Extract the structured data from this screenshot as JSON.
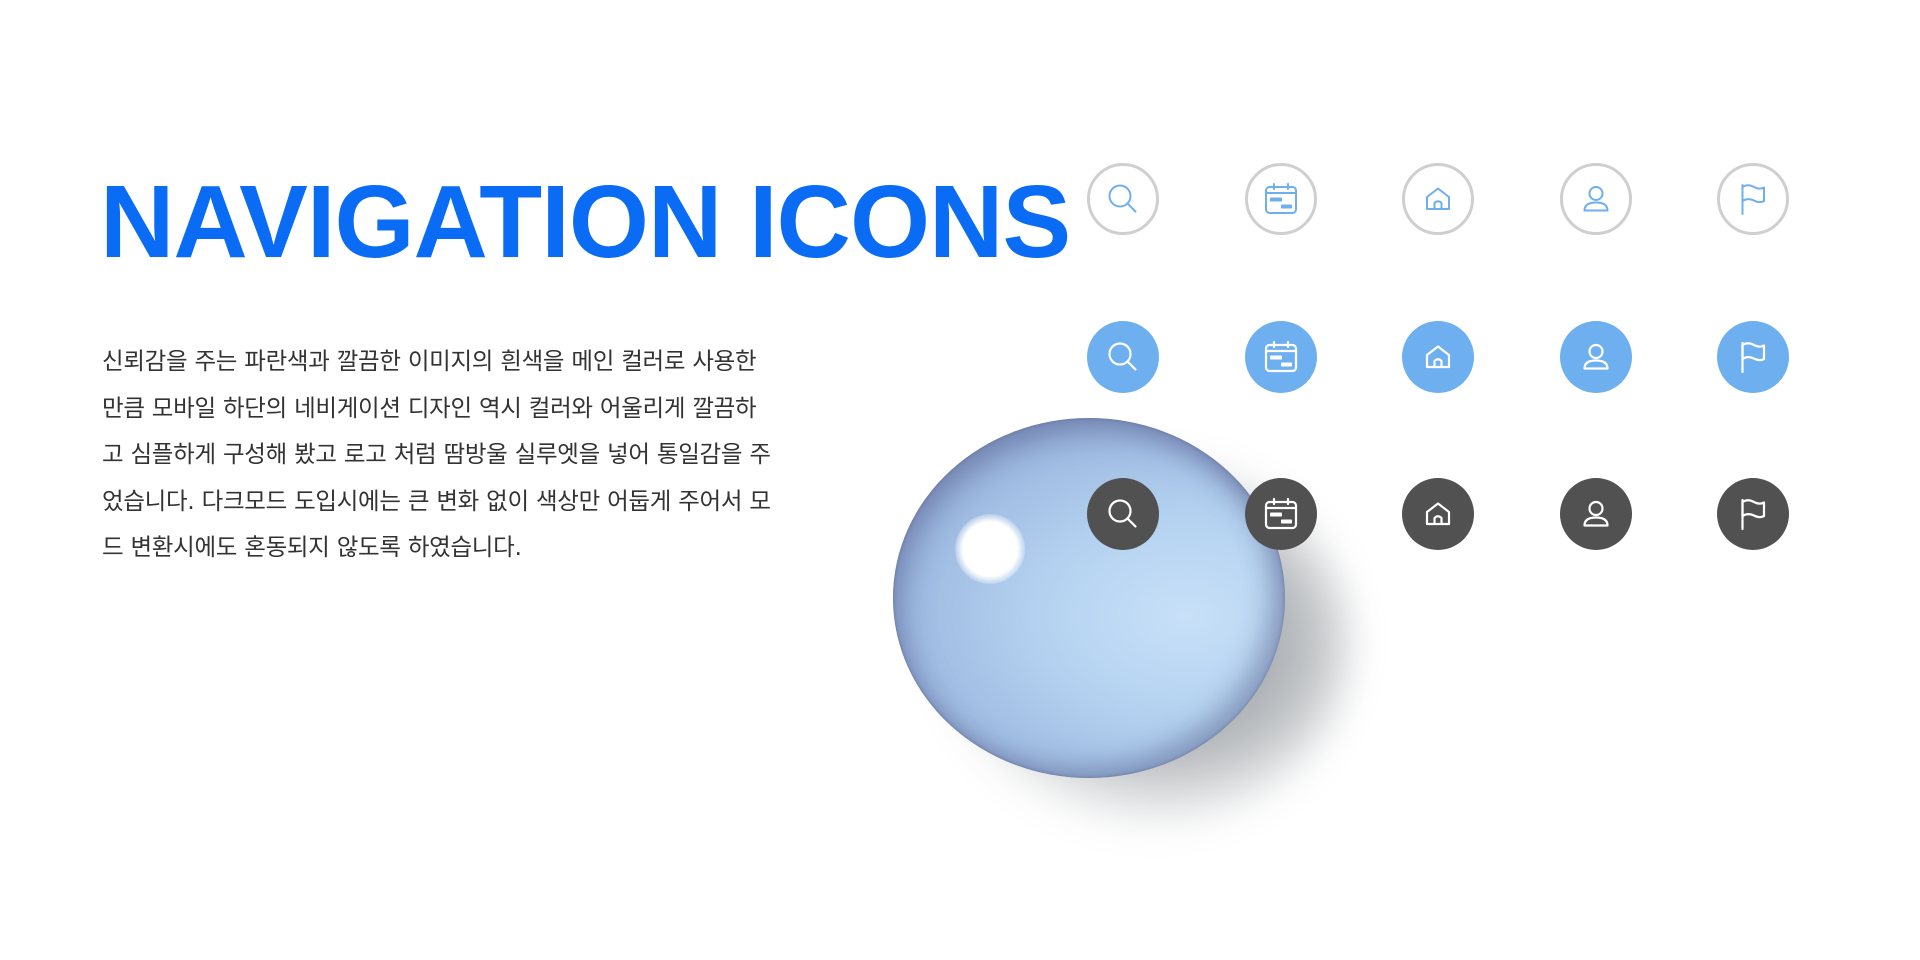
{
  "title": "NAVIGATION ICONS",
  "description": {
    "lines": [
      "신뢰감을 주는 파란색과 깔끔한 이미지의 흰색을 메인 컬러로 사용한",
      "만큼 모바일 하단의 네비게이션 디자인 역시 컬러와 어울리게 깔끔하",
      "고 심플하게 구성해 봤고 로고 처럼 땀방울 실루엣을 넣어 통일감을 주",
      "었습니다. 다크모드 도입시에는 큰 변화 없이 색상만 어둡게 주어서 모",
      "드 변환시에도 혼동되지 않도록 하였습니다."
    ]
  },
  "colors": {
    "title": "#0a6cf5",
    "body_text": "#333333",
    "light_row_stroke": "#6eaff0",
    "light_row_border": "#cfcfcf",
    "blue_row_fill": "#6eaff0",
    "dark_row_fill": "#515151",
    "icon_on_fill": "#ffffff"
  },
  "icon_rows": [
    {
      "variant": "light",
      "icons": [
        "search-icon",
        "calendar-icon",
        "home-icon",
        "user-icon",
        "flag-icon"
      ]
    },
    {
      "variant": "blue",
      "icons": [
        "search-icon",
        "calendar-icon",
        "home-icon",
        "user-icon",
        "flag-icon"
      ]
    },
    {
      "variant": "dark",
      "icons": [
        "search-icon",
        "calendar-icon",
        "home-icon",
        "user-icon",
        "flag-icon"
      ]
    }
  ]
}
